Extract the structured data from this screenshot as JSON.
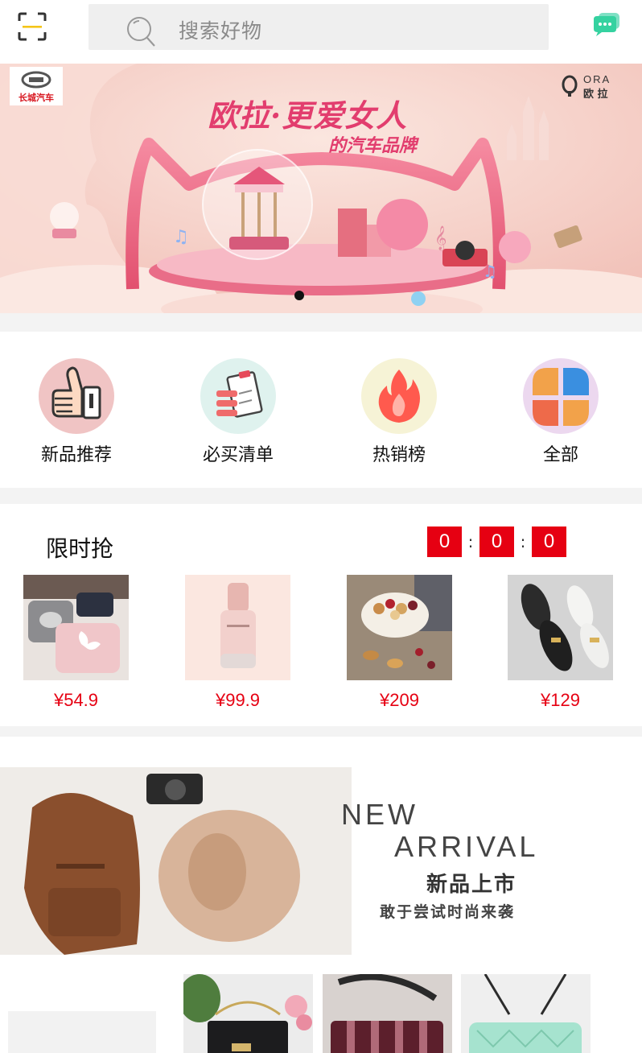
{
  "search": {
    "placeholder": "搜索好物"
  },
  "banner": {
    "headline": "欧拉·更爱女人",
    "subline": "的汽车品牌",
    "left_logo": "长城汽车",
    "right_logo_top": "ORA",
    "right_logo_bottom": "欧 拉",
    "slide_count": 1,
    "active_slide": 1
  },
  "categories": [
    {
      "label": "新品推荐",
      "icon": "thumbs-up-icon",
      "bg": "#f0c4c4"
    },
    {
      "label": "必买清单",
      "icon": "clipboard-list-icon",
      "bg": "#dff2ee"
    },
    {
      "label": "热销榜",
      "icon": "fire-icon",
      "bg": "#f6f3d6"
    },
    {
      "label": "全部",
      "icon": "grid-petals-icon",
      "bg": "#ecd8ef"
    }
  ],
  "flash_sale": {
    "title": "限时抢",
    "timer": [
      "0",
      "0",
      "0"
    ],
    "separator": ":",
    "products": [
      {
        "price": "¥54.9"
      },
      {
        "price": "¥99.9"
      },
      {
        "price": "¥209"
      },
      {
        "price": "¥129"
      }
    ]
  },
  "new_arrival": {
    "line1": "NEW",
    "line2": "ARRIVAL",
    "line3": "新品上市",
    "line4": "敢于尝试时尚来袭"
  },
  "colors": {
    "accent_red": "#e60012",
    "chat_green": "#35d2a0",
    "scan_yellow": "#f5c518"
  }
}
